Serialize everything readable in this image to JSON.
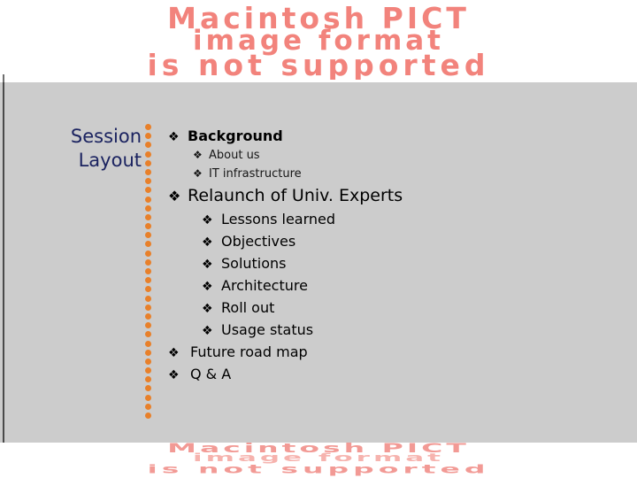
{
  "placeholder": {
    "line1": "Macintosh PICT",
    "line2": "image format",
    "line3": "is not supported",
    "color": "#f2837c"
  },
  "slide": {
    "background_color": "#cccccc",
    "title_color": "#1b2360",
    "divider_color": "#e8802a",
    "title_line1": "Session",
    "title_line2": "Layout",
    "bullet_glyph": "❖",
    "outline": [
      {
        "level": 1,
        "style": "bold",
        "text": "Background"
      },
      {
        "level": 2,
        "style": "small",
        "text": "About us"
      },
      {
        "level": 2,
        "style": "small",
        "text": "IT infrastructure"
      },
      {
        "level": 1,
        "style": "big",
        "text": "Relaunch of Univ. Experts"
      },
      {
        "level": 2,
        "style": "normal",
        "text": "Lessons learned"
      },
      {
        "level": 2,
        "style": "normal",
        "text": "Objectives"
      },
      {
        "level": 2,
        "style": "normal",
        "text": "Solutions"
      },
      {
        "level": 2,
        "style": "normal",
        "text": "Architecture"
      },
      {
        "level": 2,
        "style": "normal",
        "text": " Roll out"
      },
      {
        "level": 2,
        "style": "normal",
        "text": " Usage status"
      },
      {
        "level": 1,
        "style": "plain",
        "text": "Future road map"
      },
      {
        "level": 1,
        "style": "plain",
        "text": "Q & A"
      }
    ]
  }
}
